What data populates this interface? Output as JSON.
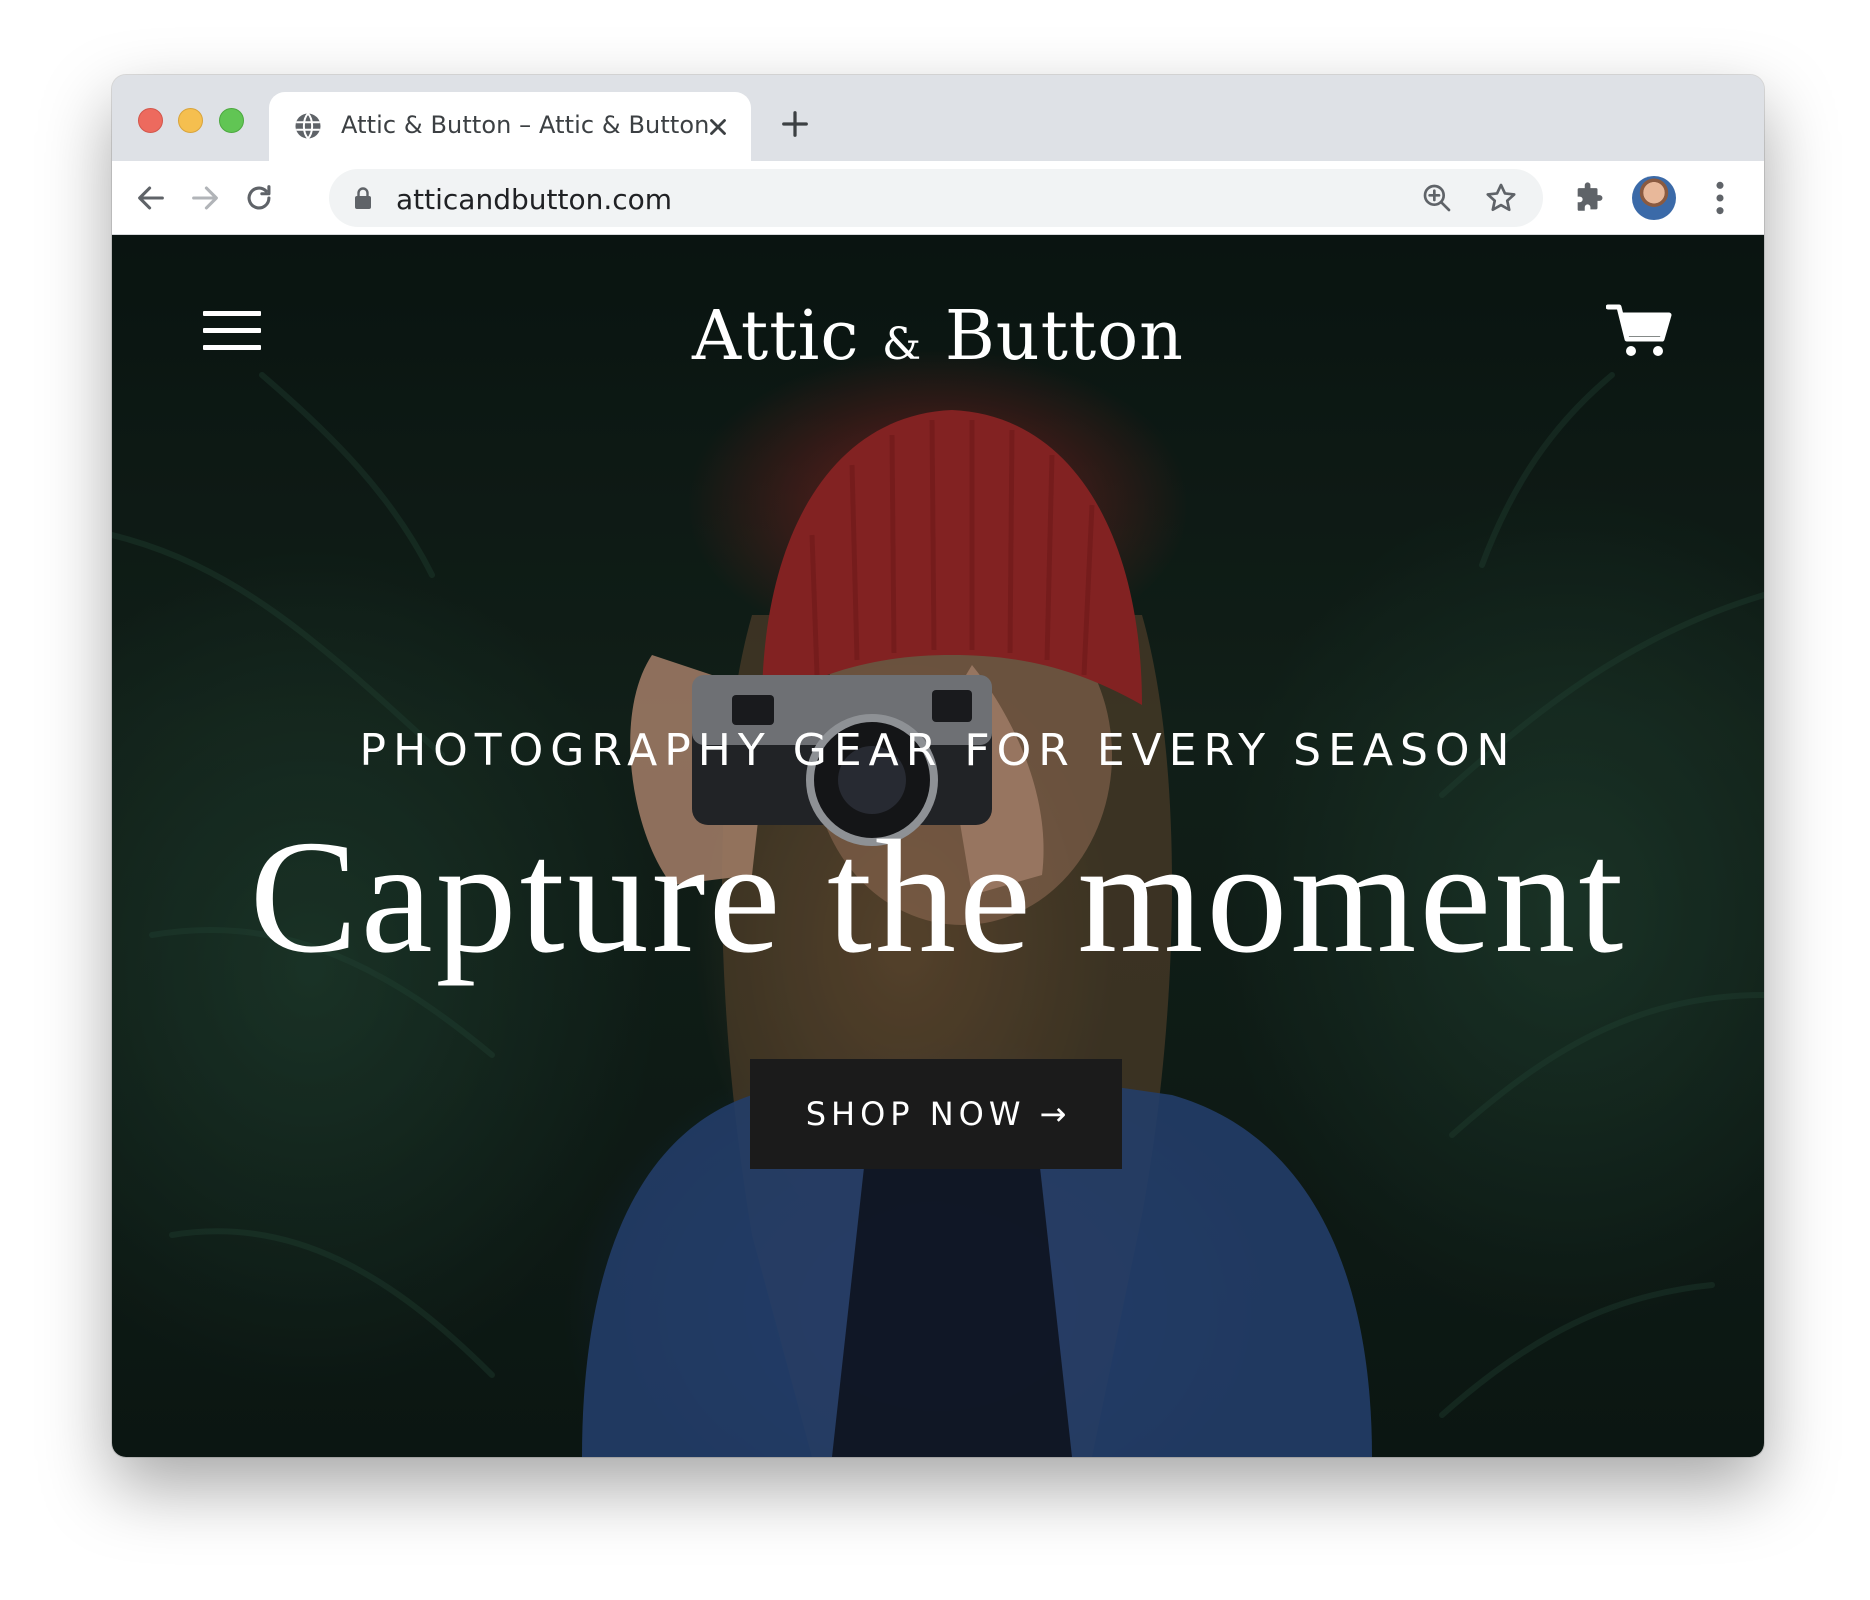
{
  "browser": {
    "tab_title": "Attic & Button – Attic & Button",
    "url": "atticandbutton.com",
    "new_tab_symbol": "+"
  },
  "site": {
    "brand_left": "Attic",
    "brand_amp": "&",
    "brand_right": "Button",
    "hero": {
      "kicker": "PHOTOGRAPHY GEAR FOR EVERY SEASON",
      "headline": "Capture the moment",
      "cta_label": "SHOP NOW",
      "cta_arrow": "→"
    }
  },
  "icons": {
    "tab_favicon": "globe-icon",
    "tab_close": "close-icon",
    "back": "back-arrow-icon",
    "forward": "forward-arrow-icon",
    "reload": "reload-icon",
    "lock": "lock-icon",
    "zoom": "zoom-in-icon",
    "bookmark": "star-icon",
    "extensions": "puzzle-icon",
    "menu": "kebab-menu-icon",
    "site_menu": "hamburger-icon",
    "cart": "cart-icon"
  },
  "colors": {
    "tabstrip_bg": "#dee1e6",
    "cta_bg": "#1b1b1b",
    "hero_text": "#ffffff",
    "traffic_red": "#ed6a5e",
    "traffic_yellow": "#f5bf4f",
    "traffic_green": "#61c554"
  }
}
